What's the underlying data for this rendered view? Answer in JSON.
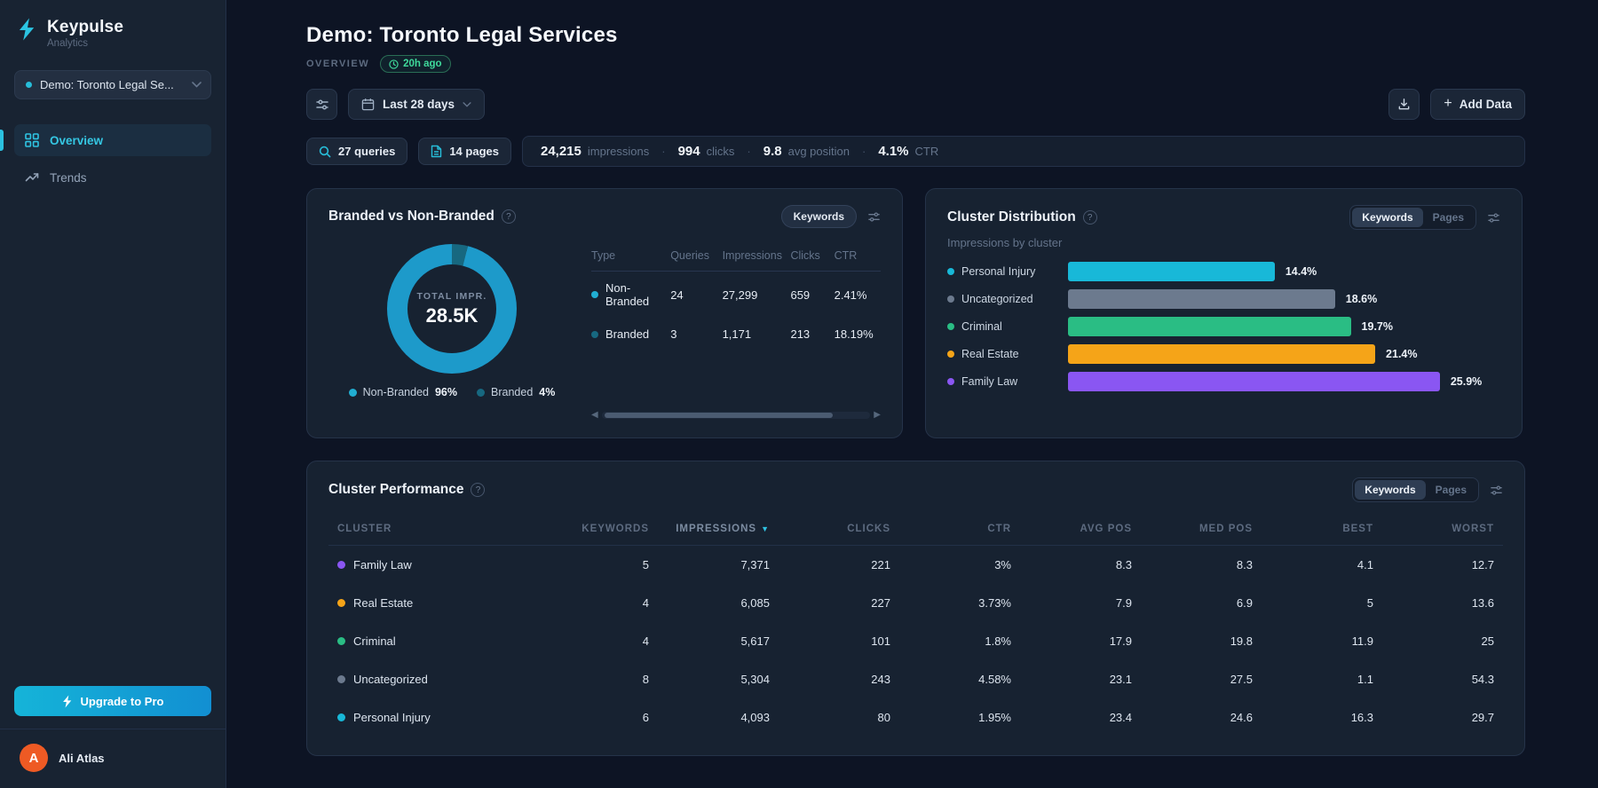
{
  "app": {
    "name": "Keypulse",
    "tagline": "Analytics"
  },
  "colors": {
    "accent_cyan": "#27bdd9",
    "non_branded": "#1d9aca",
    "branded": "#176880",
    "personal_injury": "#18b8d8",
    "uncategorized": "#6c7a8e",
    "criminal": "#2abd84",
    "real_estate": "#f5a418",
    "family_law": "#8a56f2",
    "badge_green": "#3fd99b",
    "avatar_orange": "#ee5a24"
  },
  "sidebar": {
    "workspace": "Demo: Toronto Legal Se...",
    "nav": [
      {
        "label": "Overview",
        "active": true
      },
      {
        "label": "Trends",
        "active": false
      }
    ],
    "upgrade_label": "Upgrade to Pro",
    "user": {
      "name": "Ali Atlas",
      "initial": "A"
    }
  },
  "header": {
    "title": "Demo: Toronto Legal Services",
    "section": "OVERVIEW",
    "updated": "20h ago",
    "date_range": "Last 28 days",
    "add_data_label": "Add Data"
  },
  "stats": {
    "queries_chip": "27 queries",
    "pages_chip": "14 pages",
    "metrics": [
      {
        "value": "24,215",
        "label": "impressions"
      },
      {
        "value": "994",
        "label": "clicks"
      },
      {
        "value": "9.8",
        "label": "avg position"
      },
      {
        "value": "4.1%",
        "label": "CTR"
      }
    ]
  },
  "branded_card": {
    "title": "Branded vs Non-Branded",
    "toggle": "Keywords",
    "chart": {
      "type": "donut",
      "center_label": "TOTAL IMPR.",
      "center_value": "28.5K",
      "segments": [
        {
          "name": "Non-Branded",
          "pct": 96,
          "color": "#1d9aca"
        },
        {
          "name": "Branded",
          "pct": 4,
          "color": "#176880"
        }
      ]
    },
    "legend": [
      {
        "label": "Non-Branded",
        "value": "96%",
        "color": "#21aed2"
      },
      {
        "label": "Branded",
        "value": "4%",
        "color": "#176880"
      }
    ],
    "table": {
      "columns": [
        "Type",
        "Queries",
        "Impressions",
        "Clicks",
        "CTR"
      ],
      "rows": [
        {
          "type": "Non-Branded",
          "color": "#21aed2",
          "queries": "24",
          "impressions": "27,299",
          "clicks": "659",
          "ctr": "2.41%"
        },
        {
          "type": "Branded",
          "color": "#176880",
          "queries": "3",
          "impressions": "1,171",
          "clicks": "213",
          "ctr": "18.19%"
        }
      ]
    }
  },
  "distribution_card": {
    "title": "Cluster Distribution",
    "subtitle": "Impressions by cluster",
    "toggles": [
      "Keywords",
      "Pages"
    ],
    "active_toggle": "Keywords",
    "chart_data": {
      "type": "bar",
      "orientation": "horizontal",
      "categories": [
        "Personal Injury",
        "Uncategorized",
        "Criminal",
        "Real Estate",
        "Family Law"
      ],
      "values": [
        14.4,
        18.6,
        19.7,
        21.4,
        25.9
      ],
      "labels": [
        "14.4%",
        "18.6%",
        "19.7%",
        "21.4%",
        "25.9%"
      ],
      "colors": [
        "#18b8d8",
        "#6c7a8e",
        "#2abd84",
        "#f5a418",
        "#8a56f2"
      ]
    }
  },
  "performance_card": {
    "title": "Cluster Performance",
    "toggles": [
      "Keywords",
      "Pages"
    ],
    "active_toggle": "Keywords",
    "sorted_column": "IMPRESSIONS",
    "columns": [
      "CLUSTER",
      "KEYWORDS",
      "IMPRESSIONS",
      "CLICKS",
      "CTR",
      "AVG POS",
      "MED POS",
      "BEST",
      "WORST"
    ],
    "rows": [
      {
        "cluster": "Family Law",
        "color": "#8a56f2",
        "keywords": "5",
        "impressions": "7,371",
        "clicks": "221",
        "ctr": "3%",
        "avg_pos": "8.3",
        "med_pos": "8.3",
        "best": "4.1",
        "worst": "12.7"
      },
      {
        "cluster": "Real Estate",
        "color": "#f5a418",
        "keywords": "4",
        "impressions": "6,085",
        "clicks": "227",
        "ctr": "3.73%",
        "avg_pos": "7.9",
        "med_pos": "6.9",
        "best": "5",
        "worst": "13.6"
      },
      {
        "cluster": "Criminal",
        "color": "#2abd84",
        "keywords": "4",
        "impressions": "5,617",
        "clicks": "101",
        "ctr": "1.8%",
        "avg_pos": "17.9",
        "med_pos": "19.8",
        "best": "11.9",
        "worst": "25"
      },
      {
        "cluster": "Uncategorized",
        "color": "#6c7a8e",
        "keywords": "8",
        "impressions": "5,304",
        "clicks": "243",
        "ctr": "4.58%",
        "avg_pos": "23.1",
        "med_pos": "27.5",
        "best": "1.1",
        "worst": "54.3"
      },
      {
        "cluster": "Personal Injury",
        "color": "#18b8d8",
        "keywords": "6",
        "impressions": "4,093",
        "clicks": "80",
        "ctr": "1.95%",
        "avg_pos": "23.4",
        "med_pos": "24.6",
        "best": "16.3",
        "worst": "29.7"
      }
    ]
  }
}
